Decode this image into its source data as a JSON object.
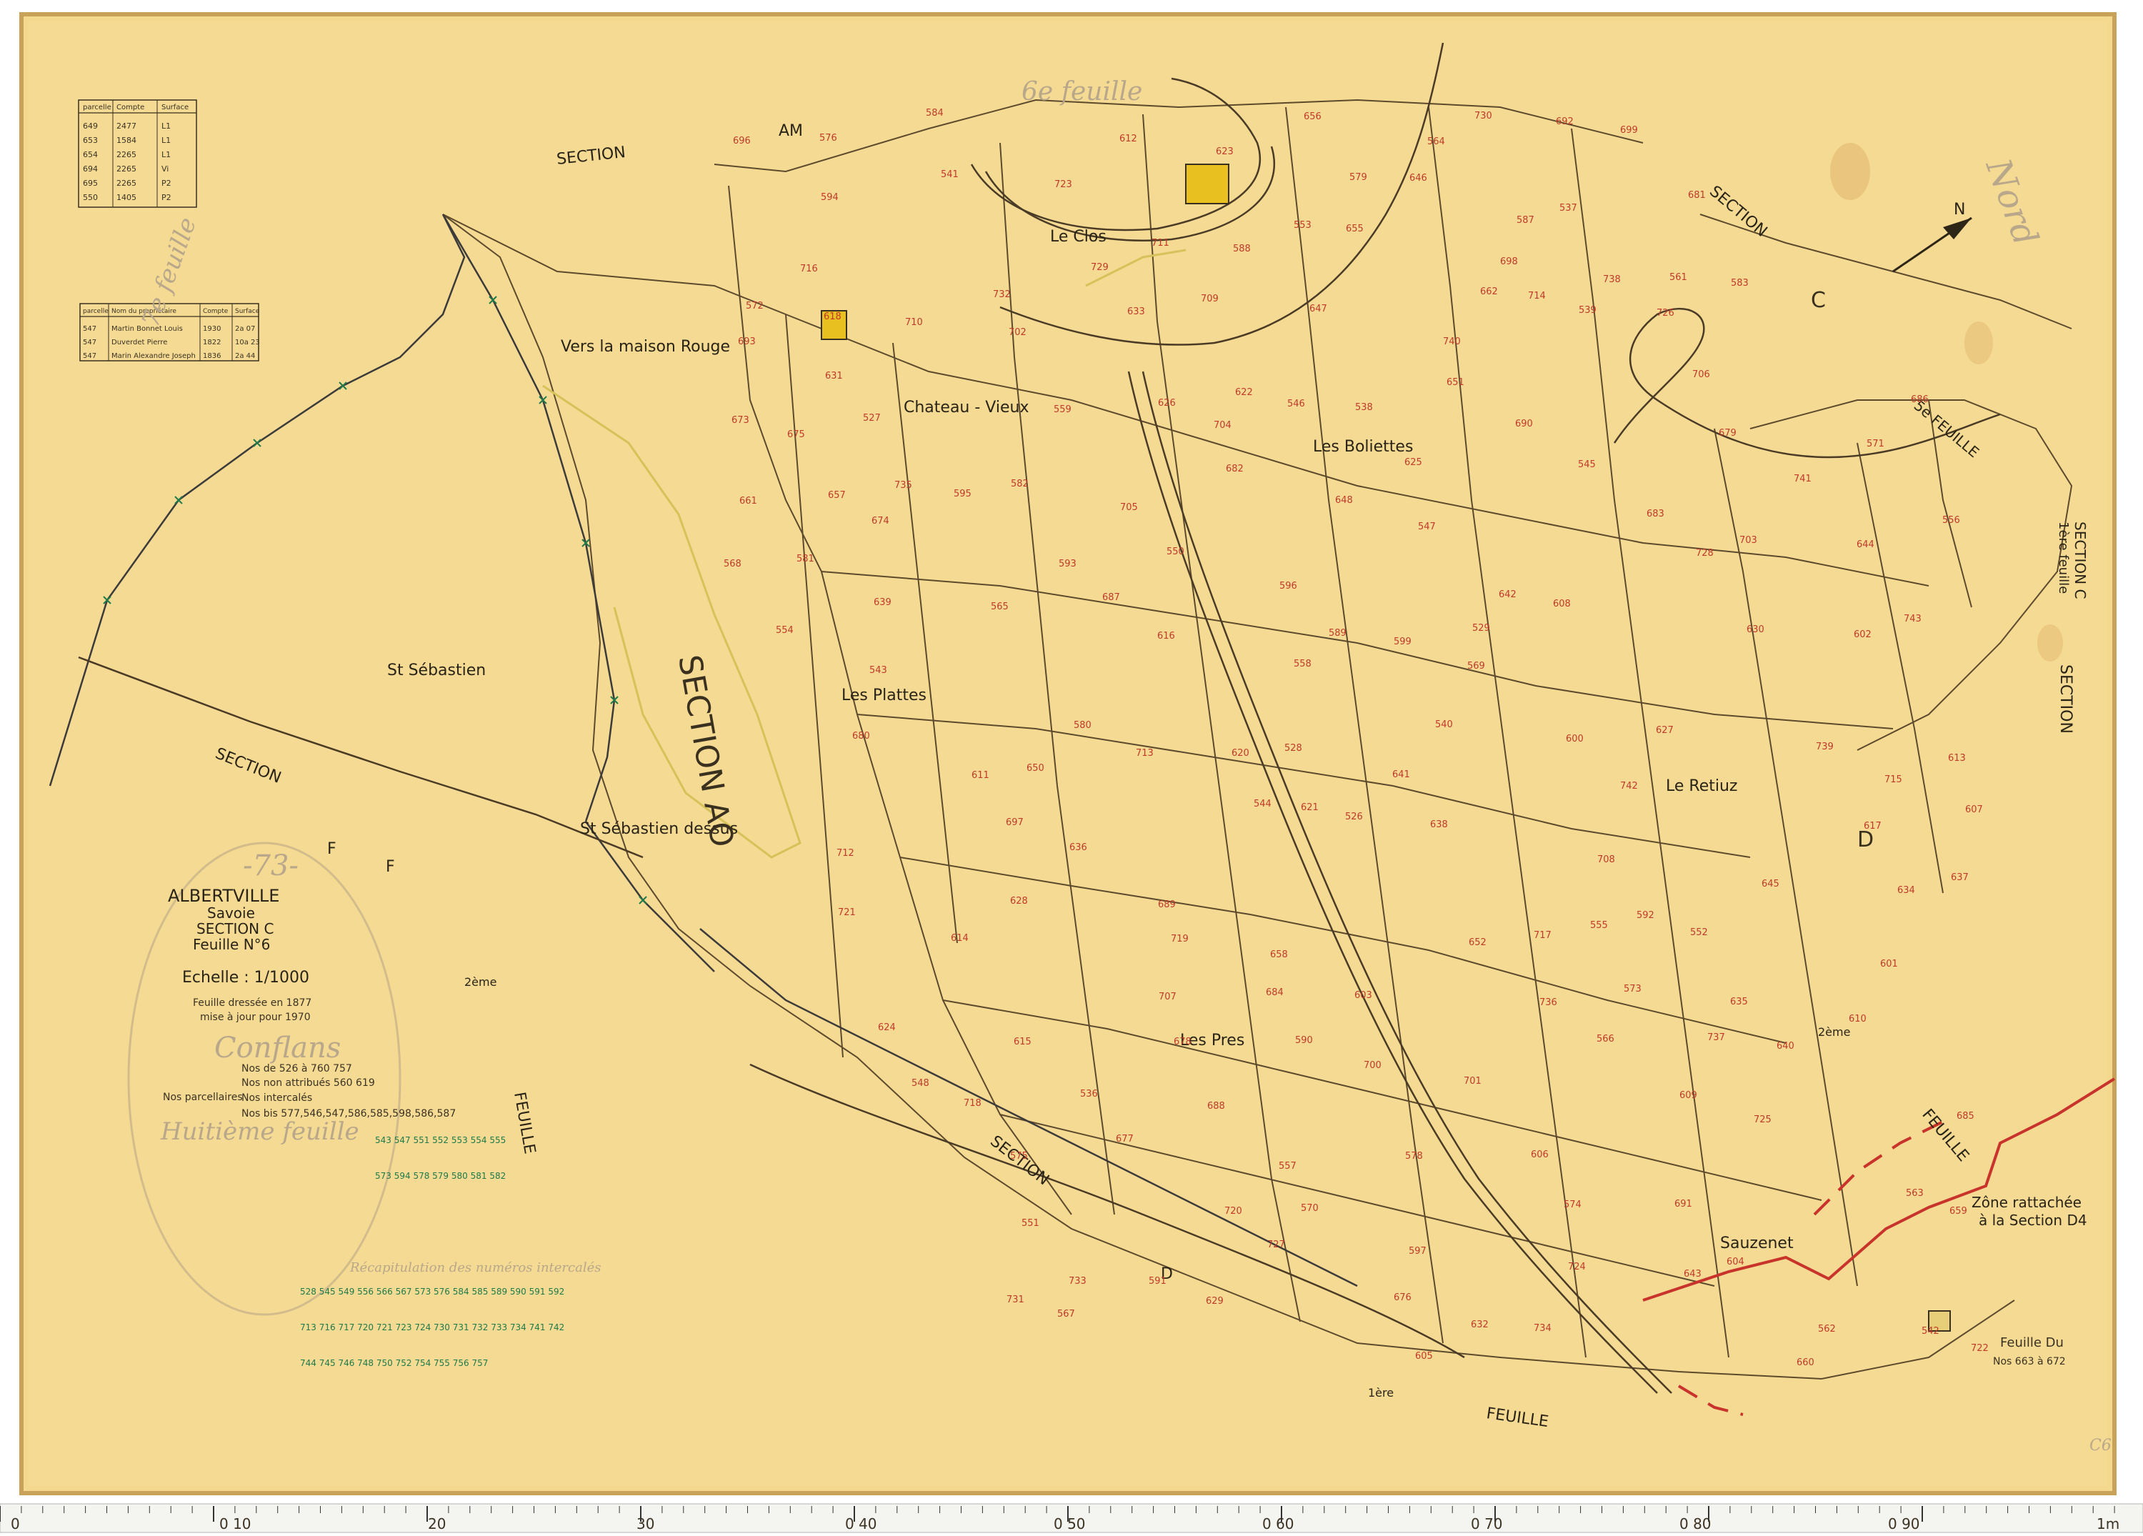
{
  "colors": {
    "paper": "#f3d88e",
    "paper_edge": "#d9b56a",
    "ink": "#2e2616",
    "parcel_number": "#c0392b",
    "boundary_red": "#c8332b",
    "boundary_yellow": "#d6c25a",
    "green_numbers": "#1e7a4a",
    "ruler_bg": "#f4f4f0",
    "ruler_mark": "#c41e1e"
  },
  "cartouche": {
    "commune_number": "-73-",
    "commune": "ALBERTVILLE",
    "departement": "Savoie",
    "section": "SECTION  C",
    "feuille": "Feuille  N°6",
    "echelle": "Echelle : 1/1000",
    "dressee": "Feuille dressée en 1877",
    "mise_a_jour": "mise à jour pour 1970",
    "old_commune": "Conflans",
    "old_feuille": "Huitième feuille",
    "nos_parcellaires_label": "Nos parcellaires",
    "rows": [
      "Nos de 526 à 760 757",
      "Nos non attribués 560 619",
      "Nos intercalés",
      "Nos bis 577,546,547,586,585,598,586,587"
    ],
    "recap_label": "Récapitulation des numéros intercalés"
  },
  "places": {
    "le_clos": "Le Clos",
    "maison_rouge": "Vers la maison Rouge",
    "chateau_vieux": "Chateau - Vieux",
    "boliettes": "Les Boliettes",
    "st_sebastien": "St Sébastien",
    "st_sebastien_dessus": "St Sébastien dessus",
    "plattes": "Les Plattes",
    "retiuz": "Le Retiuz",
    "pres": "Les Pres",
    "sauzenet": "Sauzenet"
  },
  "sections": {
    "am": "SECTION",
    "am_letters": "AM",
    "ao": "SECTION  AO",
    "c_top": "SECTION",
    "c_right": "SECTION C",
    "c_right_sub": "1ère feuille",
    "right_vertical": "SECTION",
    "left": "SECTION",
    "bottom": "SECTION",
    "f_letter": "F",
    "d_letter": "D",
    "c_letter": "C"
  },
  "feuilles": {
    "top": "6e feuille",
    "left": "7e feuille",
    "right": "5e FEUILLE",
    "bottom": "FEUILLE",
    "bottom_prefix": "1ère",
    "lower_right": "FEUILLE",
    "lower_right_prefix": "2ème",
    "left_lower": "FEUILLE",
    "left_lower_prefix": "2ème"
  },
  "north": "Nord",
  "north_arrow": "N",
  "zone_note": [
    "Zône rattachée",
    "à la Section D4"
  ],
  "feuille_du": [
    "Feuille Du",
    "Nos 663 à 672"
  ],
  "corner_mark": "C6",
  "top_table": {
    "headers": [
      "parcelle",
      "Compte",
      "Surface"
    ],
    "rows": [
      [
        "649",
        "2477",
        "L1"
      ],
      [
        "653",
        "1584",
        "L1"
      ],
      [
        "654",
        "2265",
        "L1"
      ],
      [
        "694",
        "2265",
        "Vi"
      ],
      [
        "695",
        "2265",
        "P2"
      ],
      [
        "550",
        "1405",
        "P2"
      ]
    ]
  },
  "owner_table": {
    "headers": [
      "parcelle",
      "Nom du propriétaire",
      "Compte",
      "Surface"
    ],
    "rows": [
      [
        "547",
        "Martin Bonnet Louis",
        "1930",
        "2a 07"
      ],
      [
        "547",
        "Duverdet Pierre",
        "1822",
        "10a 23"
      ],
      [
        "547",
        "Marin Alexandre Joseph",
        "1836",
        "2a 44"
      ]
    ]
  },
  "parcels": [
    "526",
    "527",
    "528",
    "529",
    "536",
    "537",
    "538",
    "539",
    "540",
    "541",
    "542",
    "543",
    "544",
    "545",
    "546",
    "547",
    "548",
    "550",
    "551",
    "552",
    "553",
    "554",
    "555",
    "556",
    "557",
    "558",
    "559",
    "561",
    "562",
    "563",
    "564",
    "565",
    "566",
    "567",
    "568",
    "569",
    "570",
    "571",
    "572",
    "573",
    "574",
    "575",
    "576",
    "578",
    "579",
    "580",
    "581",
    "582",
    "583",
    "584",
    "587",
    "588",
    "589",
    "590",
    "591",
    "592",
    "593",
    "594",
    "595",
    "596",
    "597",
    "599",
    "600",
    "601",
    "602",
    "603",
    "604",
    "605",
    "606",
    "607",
    "608",
    "609",
    "610",
    "611",
    "612",
    "613",
    "614",
    "615",
    "616",
    "617",
    "618",
    "620",
    "621",
    "622",
    "623",
    "624",
    "625",
    "626",
    "627",
    "628",
    "629",
    "630",
    "631",
    "632",
    "633",
    "634",
    "635",
    "636",
    "637",
    "638",
    "639",
    "640",
    "641",
    "642",
    "643",
    "644",
    "645",
    "646",
    "647",
    "648",
    "650",
    "651",
    "652",
    "655",
    "656",
    "657",
    "658",
    "659",
    "660",
    "661",
    "662",
    "673",
    "674",
    "675",
    "676",
    "677",
    "678",
    "679",
    "680",
    "681",
    "682",
    "683",
    "684",
    "685",
    "686",
    "687",
    "688",
    "689",
    "690",
    "691",
    "692",
    "693",
    "696",
    "697",
    "698",
    "699",
    "700",
    "701",
    "702",
    "703",
    "704",
    "705",
    "706",
    "707",
    "708",
    "709",
    "710",
    "711",
    "712",
    "713",
    "714",
    "715",
    "716",
    "717",
    "718",
    "719",
    "720",
    "721",
    "722",
    "723",
    "724",
    "725",
    "726",
    "727",
    "728",
    "729",
    "730",
    "731",
    "732",
    "733",
    "734",
    "735",
    "736",
    "737",
    "738",
    "739",
    "740",
    "741",
    "742",
    "743"
  ],
  "ruler": {
    "labels": [
      "0",
      "0 10",
      "20",
      "30",
      "0 40",
      "0 50",
      "0 60",
      "0 70",
      "0 80",
      "0 90",
      "1m"
    ]
  }
}
